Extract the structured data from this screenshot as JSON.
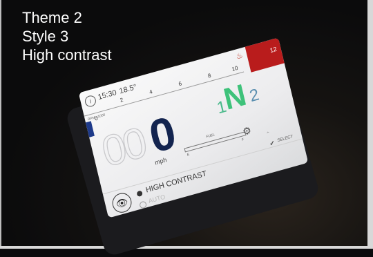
{
  "overlay": {
    "line1": "Theme 2",
    "line2": "Style 3",
    "line3": "High contrast"
  },
  "status": {
    "time": "15:30",
    "temp": "18.5°"
  },
  "tach": {
    "label": "RPM x1000",
    "ticks": [
      "0",
      "2",
      "4",
      "6",
      "8",
      "10",
      "12"
    ]
  },
  "speed": {
    "ghost": "00",
    "value": "0",
    "unit": "mph"
  },
  "gear": {
    "prev": "1",
    "current": "N",
    "next": "2"
  },
  "fuel": {
    "label": "FUEL",
    "empty": "E",
    "full": "F"
  },
  "menu": {
    "option1": "HIGH CONTRAST",
    "option2": "AUTO",
    "select": "SELECT"
  },
  "colors": {
    "gear": "#3ec27a",
    "speed": "#13244f",
    "redline": "#b91c1c"
  }
}
